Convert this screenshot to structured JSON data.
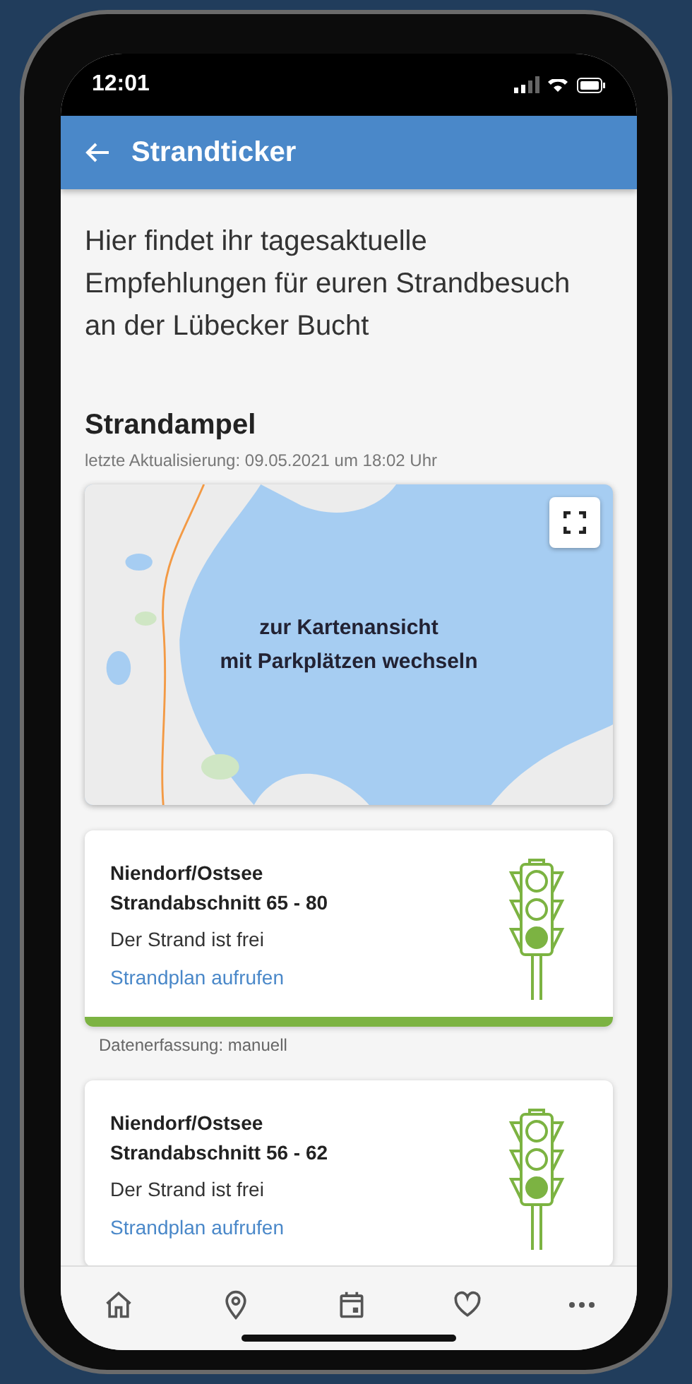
{
  "status_bar": {
    "time": "12:01"
  },
  "header": {
    "title": "Strandticker"
  },
  "intro": "Hier findet ihr tagesaktuelle Empfehlungen für euren Strandbesuch an der Lübecker Bucht",
  "section": {
    "title": "Strandampel",
    "updated": "letzte Aktualisierung: 09.05.2021 um 18:02 Uhr"
  },
  "map": {
    "caption_lines": [
      "zur Kartenansicht",
      "mit Parkplätzen wechseln"
    ]
  },
  "beaches": [
    {
      "place": "Niendorf/Ostsee",
      "section": "Strandabschnitt 65 - 80",
      "status": "Der Strand ist frei",
      "lights": [
        {
          "on": false
        },
        {
          "on": false
        },
        {
          "on": true
        }
      ],
      "link": "Strandplan aufrufen",
      "source": "Datenerfassung: manuell"
    },
    {
      "place": "Niendorf/Ostsee",
      "section": "Strandabschnitt 56 - 62",
      "status": "Der Strand ist frei",
      "lights": [
        {
          "on": false
        },
        {
          "on": false
        },
        {
          "on": true
        }
      ],
      "link": "Strandplan aufrufen"
    }
  ]
}
